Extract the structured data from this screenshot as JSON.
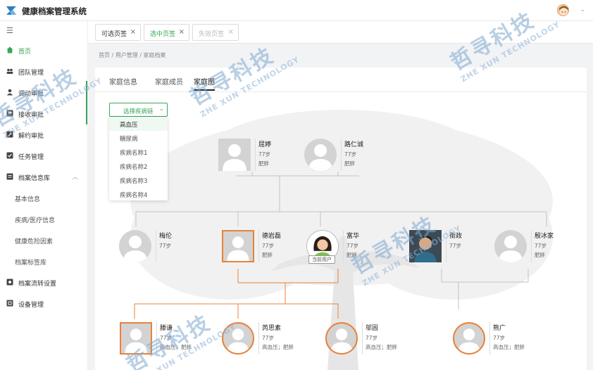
{
  "app": {
    "title": "健康档案管理系统"
  },
  "sidebar": {
    "items": [
      {
        "label": "首页",
        "icon": "home-icon"
      },
      {
        "label": "团队管理",
        "icon": "team-icon"
      },
      {
        "label": "调动审批",
        "icon": "user-icon"
      },
      {
        "label": "接收审批",
        "icon": "inbox-icon"
      },
      {
        "label": "解约审批",
        "icon": "edit-icon"
      },
      {
        "label": "任务管理",
        "icon": "task-icon"
      },
      {
        "label": "档案信息库",
        "icon": "archive-icon"
      },
      {
        "label": "档案流转设置",
        "icon": "flow-icon"
      },
      {
        "label": "设备管理",
        "icon": "device-icon"
      }
    ],
    "subitems": [
      "基本信息",
      "疾病/医疗信息",
      "健康危险因素",
      "档案标签库"
    ]
  },
  "tabs": [
    {
      "label": "可选页签"
    },
    {
      "label": "选中页签"
    },
    {
      "label": "失效页签"
    }
  ],
  "breadcrumb": "首页  /  用户管理  /  家庭档案",
  "panel": {
    "tabs": [
      "家庭信息",
      "家庭成员",
      "家庭图"
    ],
    "select_label": "选择疾病链",
    "dropdown": [
      "高血压",
      "糖尿病",
      "疾病名称1",
      "疾病名称2",
      "疾病名称3",
      "疾病名称4"
    ]
  },
  "current_user_badge": "当前用户",
  "members": {
    "gen1": [
      {
        "name": "屈婷",
        "age": "77岁",
        "tags": "肥胖"
      },
      {
        "name": "路仁诚",
        "age": "77岁",
        "tags": "肥胖"
      }
    ],
    "gen2": [
      {
        "name": "梅伦",
        "age": "77岁",
        "tags": ""
      },
      {
        "name": "德岩磊",
        "age": "77岁",
        "tags": "肥胖"
      },
      {
        "name": "富华",
        "age": "77岁",
        "tags": "肥胖"
      },
      {
        "name": "衡政",
        "age": "77岁",
        "tags": ""
      },
      {
        "name": "殷冰家",
        "age": "77岁",
        "tags": "肥胖"
      }
    ],
    "gen3": [
      {
        "name": "滕谦",
        "age": "77岁",
        "tags": "高血压；肥胖"
      },
      {
        "name": "芮思素",
        "age": "77岁",
        "tags": "高血压；肥胖"
      },
      {
        "name": "邬固",
        "age": "77岁",
        "tags": "高血压；肥胖"
      },
      {
        "name": "熊广",
        "age": "77岁",
        "tags": "高血压；肥胖"
      }
    ]
  },
  "watermark": {
    "cn": "哲寻科技",
    "en": "ZHE XUN TECHNOLOGY"
  },
  "colors": {
    "accent": "#3aa55a",
    "highlight": "#e8823a"
  }
}
